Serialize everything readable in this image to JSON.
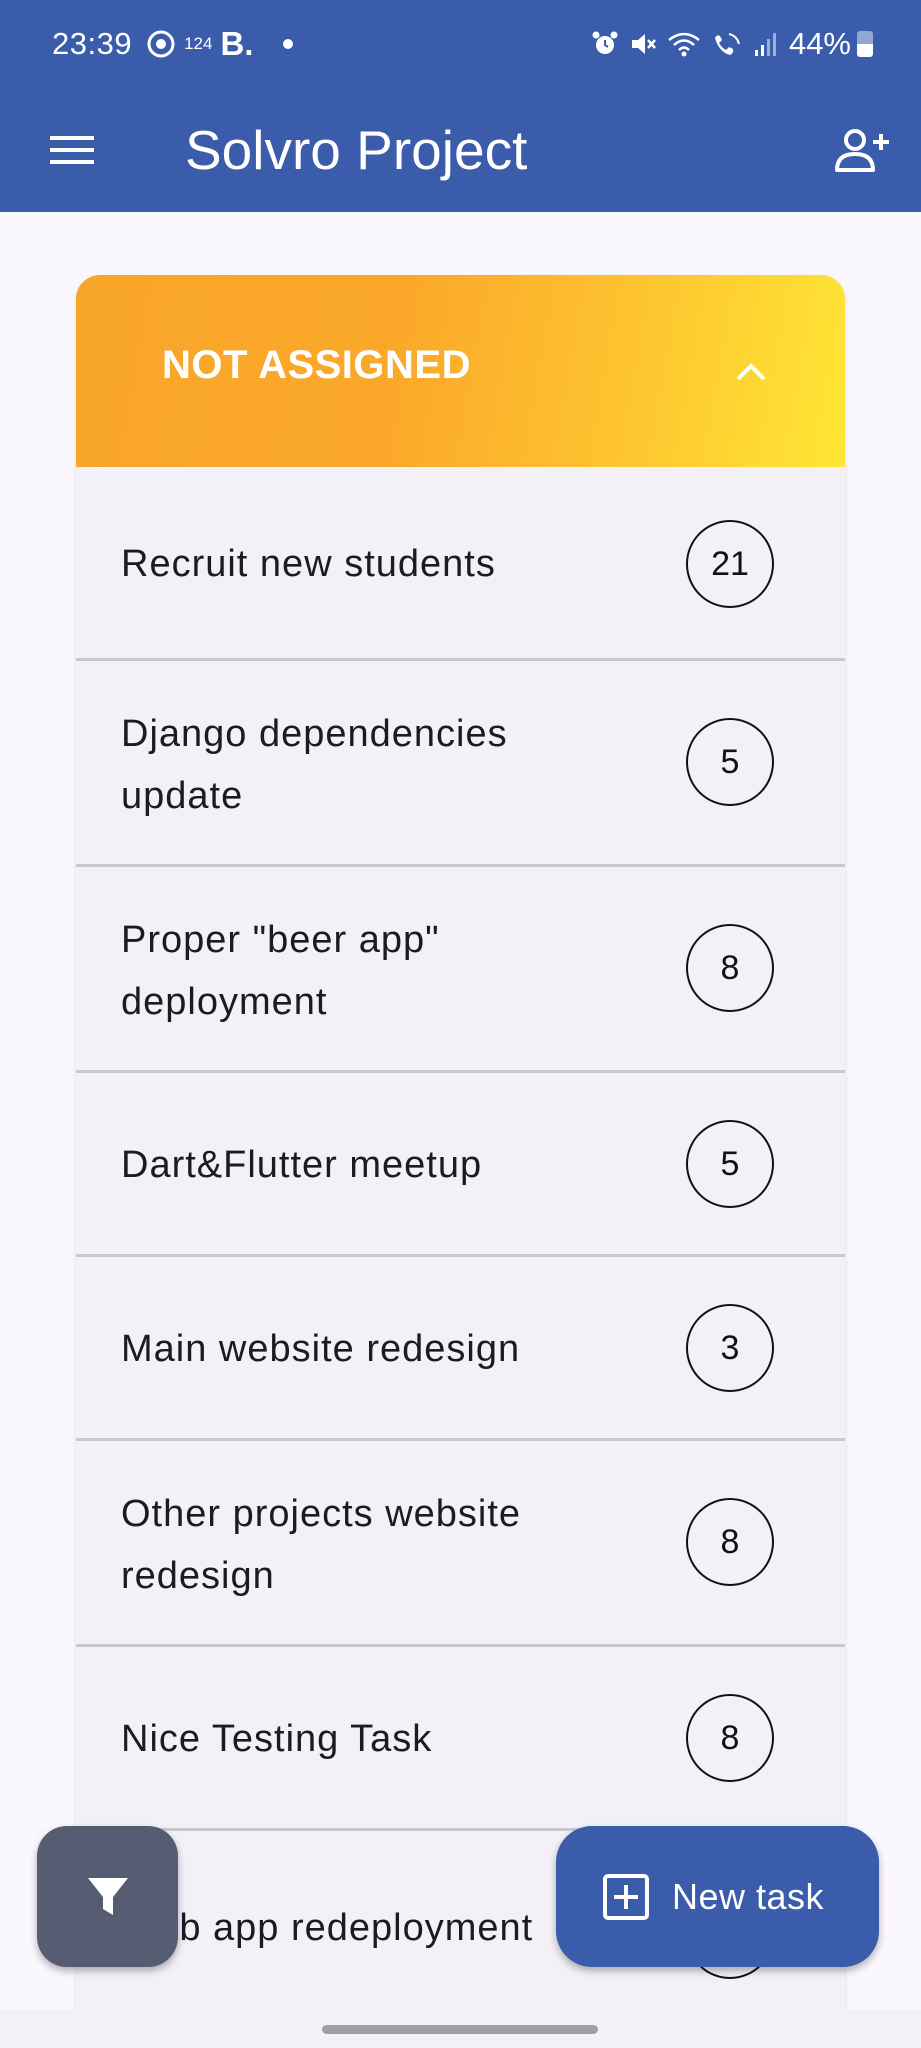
{
  "status_bar": {
    "time": "23:39",
    "small_text": "124",
    "b_label": "B.",
    "battery": "44%"
  },
  "app_bar": {
    "title": "Solvro Project",
    "menu_icon": "menu-icon",
    "add_icon": "person-add-icon"
  },
  "section": {
    "title": "NOT ASSIGNED",
    "toggle_icon": "chevron-up-icon"
  },
  "tasks": [
    {
      "label": "Recruit new students",
      "points": "21"
    },
    {
      "label": "Django dependencies update",
      "points": "5"
    },
    {
      "label": "Proper \"beer app\" deployment",
      "points": "8"
    },
    {
      "label": "Dart&Flutter meetup",
      "points": "5"
    },
    {
      "label": "Main website redesign",
      "points": "3"
    },
    {
      "label": "Other projects website redesign",
      "points": "8"
    },
    {
      "label": "Nice Testing Task",
      "points": "8"
    },
    {
      "label": "Web app redeployment",
      "points": ""
    }
  ],
  "fabs": {
    "filter_icon": "filter-icon",
    "new_task_label": "New task",
    "new_task_icon": "add-box-icon"
  },
  "colors": {
    "primary": "#3b5bab",
    "header_gradient_start": "#f8a62a",
    "header_gradient_end": "#ffe635",
    "filter_fab": "#565d72"
  }
}
